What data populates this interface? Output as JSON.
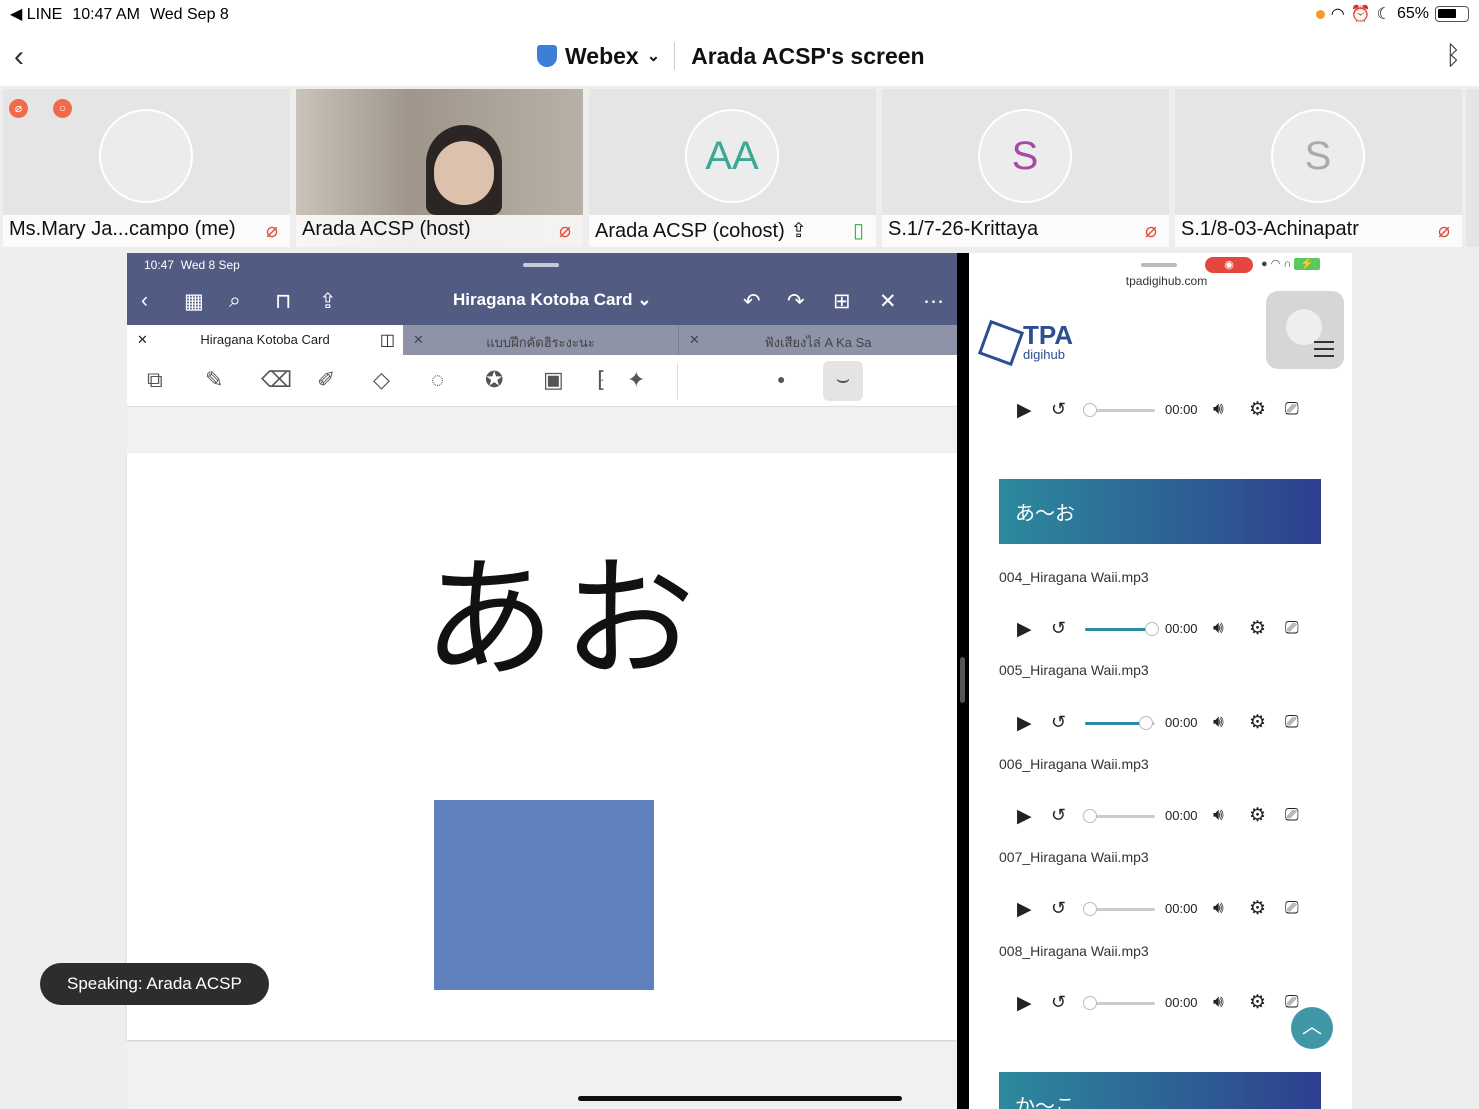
{
  "status_bar": {
    "app": "◀ LINE",
    "time": "10:47 AM",
    "date": "Wed Sep 8",
    "battery": "65%"
  },
  "title_bar": {
    "app_name": "Webex",
    "screen_title": "Arada ACSP's screen"
  },
  "participants": [
    {
      "name": "Ms.Mary Ja...campo (me)",
      "initials": ""
    },
    {
      "name": "Arada ACSP (host)",
      "initials": ""
    },
    {
      "name": "Arada ACSP (cohost)",
      "initials": "AA"
    },
    {
      "name": "S.1/7-26-Krittaya",
      "initials": "S"
    },
    {
      "name": "S.1/8-03-Achinapatr",
      "initials": "S"
    }
  ],
  "speaking": "Speaking: Arada ACSP",
  "goodnotes": {
    "time": "10:47",
    "date": "Wed 8 Sep",
    "doc_title": "Hiragana Kotoba Card ⌄",
    "tabs": [
      "Hiragana Kotoba Card",
      "แบบฝึกคัดฮิระงะนะ",
      "ฟังเสียงไล่ A Ka Sa"
    ],
    "page_text": "あお"
  },
  "browser": {
    "url": "tpadigihub.com",
    "logo_main": "TPA",
    "logo_sub": "digihub",
    "banner_1": "あ～お",
    "banner_2": "か～こ",
    "files": [
      "004_Hiragana Waii.mp3",
      "005_Hiragana Waii.mp3",
      "006_Hiragana Waii.mp3",
      "007_Hiragana Waii.mp3",
      "008_Hiragana Waii.mp3"
    ],
    "player_time": "00:00",
    "progress": [
      0,
      1,
      0.9,
      0,
      0,
      0
    ]
  }
}
